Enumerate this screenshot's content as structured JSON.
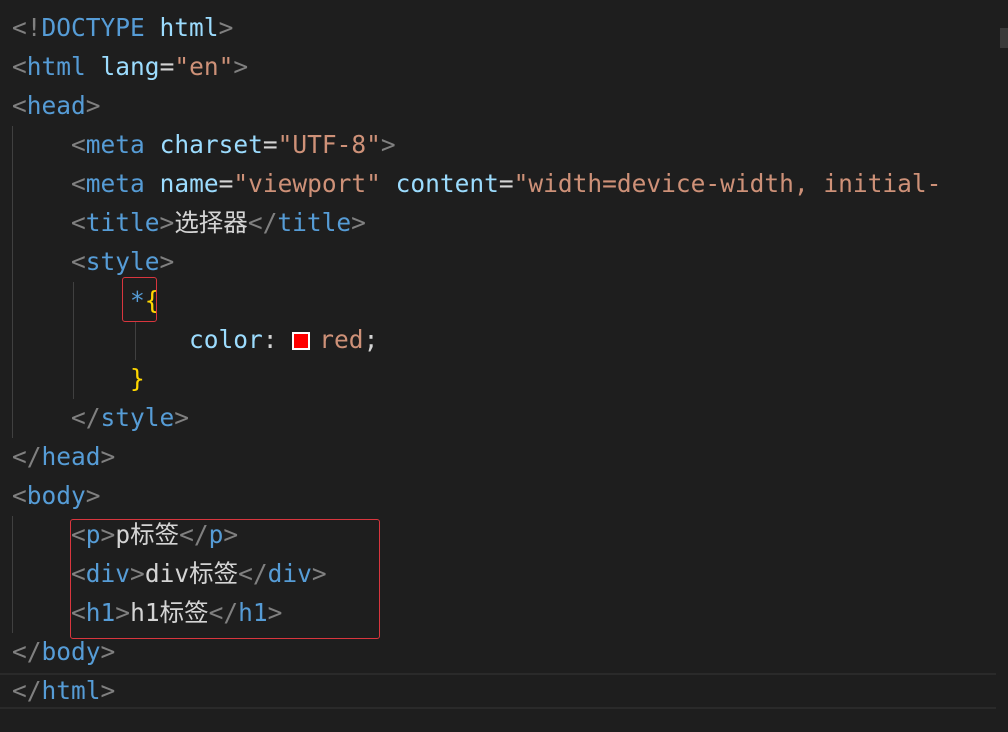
{
  "editor": {
    "lines": [
      [
        {
          "t": "<!",
          "c": "punct"
        },
        {
          "t": "DOCTYPE",
          "c": "tag"
        },
        {
          "t": " ",
          "c": "plain"
        },
        {
          "t": "html",
          "c": "attr"
        },
        {
          "t": ">",
          "c": "punct"
        }
      ],
      [
        {
          "t": "<",
          "c": "punct"
        },
        {
          "t": "html",
          "c": "tag"
        },
        {
          "t": " ",
          "c": "plain"
        },
        {
          "t": "lang",
          "c": "attr"
        },
        {
          "t": "=",
          "c": "op"
        },
        {
          "t": "\"en\"",
          "c": "str"
        },
        {
          "t": ">",
          "c": "punct"
        }
      ],
      [
        {
          "t": "<",
          "c": "punct"
        },
        {
          "t": "head",
          "c": "tag"
        },
        {
          "t": ">",
          "c": "punct"
        }
      ],
      [
        {
          "t": "    ",
          "c": "plain"
        },
        {
          "t": "<",
          "c": "punct"
        },
        {
          "t": "meta",
          "c": "tag"
        },
        {
          "t": " ",
          "c": "plain"
        },
        {
          "t": "charset",
          "c": "attr"
        },
        {
          "t": "=",
          "c": "op"
        },
        {
          "t": "\"UTF-8\"",
          "c": "str"
        },
        {
          "t": ">",
          "c": "punct"
        }
      ],
      [
        {
          "t": "    ",
          "c": "plain"
        },
        {
          "t": "<",
          "c": "punct"
        },
        {
          "t": "meta",
          "c": "tag"
        },
        {
          "t": " ",
          "c": "plain"
        },
        {
          "t": "name",
          "c": "attr"
        },
        {
          "t": "=",
          "c": "op"
        },
        {
          "t": "\"viewport\"",
          "c": "str"
        },
        {
          "t": " ",
          "c": "plain"
        },
        {
          "t": "content",
          "c": "attr"
        },
        {
          "t": "=",
          "c": "op"
        },
        {
          "t": "\"width=device-width, initial-",
          "c": "str"
        }
      ],
      [
        {
          "t": "    ",
          "c": "plain"
        },
        {
          "t": "<",
          "c": "punct"
        },
        {
          "t": "title",
          "c": "tag"
        },
        {
          "t": ">",
          "c": "punct"
        },
        {
          "t": "选择器",
          "c": "plain"
        },
        {
          "t": "</",
          "c": "punct"
        },
        {
          "t": "title",
          "c": "tag"
        },
        {
          "t": ">",
          "c": "punct"
        }
      ],
      [
        {
          "t": "    ",
          "c": "plain"
        },
        {
          "t": "<",
          "c": "punct"
        },
        {
          "t": "style",
          "c": "tag"
        },
        {
          "t": ">",
          "c": "punct"
        }
      ],
      [
        {
          "t": "        ",
          "c": "plain"
        },
        {
          "t": "*",
          "c": "sel"
        },
        {
          "t": "{",
          "c": "brace"
        }
      ],
      [
        {
          "t": "            ",
          "c": "plain"
        },
        {
          "t": "color",
          "c": "prop"
        },
        {
          "t": ": ",
          "c": "op"
        },
        {
          "t": "",
          "c": "swatch"
        },
        {
          "t": "red",
          "c": "val"
        },
        {
          "t": ";",
          "c": "op"
        }
      ],
      [
        {
          "t": "        ",
          "c": "plain"
        },
        {
          "t": "}",
          "c": "brace"
        }
      ],
      [
        {
          "t": "    ",
          "c": "plain"
        },
        {
          "t": "</",
          "c": "punct"
        },
        {
          "t": "style",
          "c": "tag"
        },
        {
          "t": ">",
          "c": "punct"
        }
      ],
      [
        {
          "t": "</",
          "c": "punct"
        },
        {
          "t": "head",
          "c": "tag"
        },
        {
          "t": ">",
          "c": "punct"
        }
      ],
      [
        {
          "t": "<",
          "c": "punct"
        },
        {
          "t": "body",
          "c": "tag"
        },
        {
          "t": ">",
          "c": "punct"
        }
      ],
      [
        {
          "t": "    ",
          "c": "plain"
        },
        {
          "t": "<",
          "c": "punct"
        },
        {
          "t": "p",
          "c": "tag"
        },
        {
          "t": ">",
          "c": "punct"
        },
        {
          "t": "p标签",
          "c": "plain"
        },
        {
          "t": "</",
          "c": "punct"
        },
        {
          "t": "p",
          "c": "tag"
        },
        {
          "t": ">",
          "c": "punct"
        }
      ],
      [
        {
          "t": "    ",
          "c": "plain"
        },
        {
          "t": "<",
          "c": "punct"
        },
        {
          "t": "div",
          "c": "tag"
        },
        {
          "t": ">",
          "c": "punct"
        },
        {
          "t": "div标签",
          "c": "plain"
        },
        {
          "t": "</",
          "c": "punct"
        },
        {
          "t": "div",
          "c": "tag"
        },
        {
          "t": ">",
          "c": "punct"
        }
      ],
      [
        {
          "t": "    ",
          "c": "plain"
        },
        {
          "t": "<",
          "c": "punct"
        },
        {
          "t": "h1",
          "c": "tag"
        },
        {
          "t": ">",
          "c": "punct"
        },
        {
          "t": "h1标签",
          "c": "plain"
        },
        {
          "t": "</",
          "c": "punct"
        },
        {
          "t": "h1",
          "c": "tag"
        },
        {
          "t": ">",
          "c": "punct"
        }
      ],
      [
        {
          "t": "</",
          "c": "punct"
        },
        {
          "t": "body",
          "c": "tag"
        },
        {
          "t": ">",
          "c": "punct"
        }
      ],
      [
        {
          "t": "</",
          "c": "punct"
        },
        {
          "t": "html",
          "c": "tag"
        },
        {
          "t": ">",
          "c": "punct"
        }
      ]
    ],
    "colors": {
      "background": "#1e1e1e",
      "tag": "#569cd6",
      "attribute": "#9cdcfe",
      "string": "#ce9178",
      "punctuation": "#808080",
      "brace": "#ffd700",
      "swatch": "#ff0000",
      "annotation_box": "#d9363e"
    },
    "color_swatch_value": "#ff0000"
  }
}
